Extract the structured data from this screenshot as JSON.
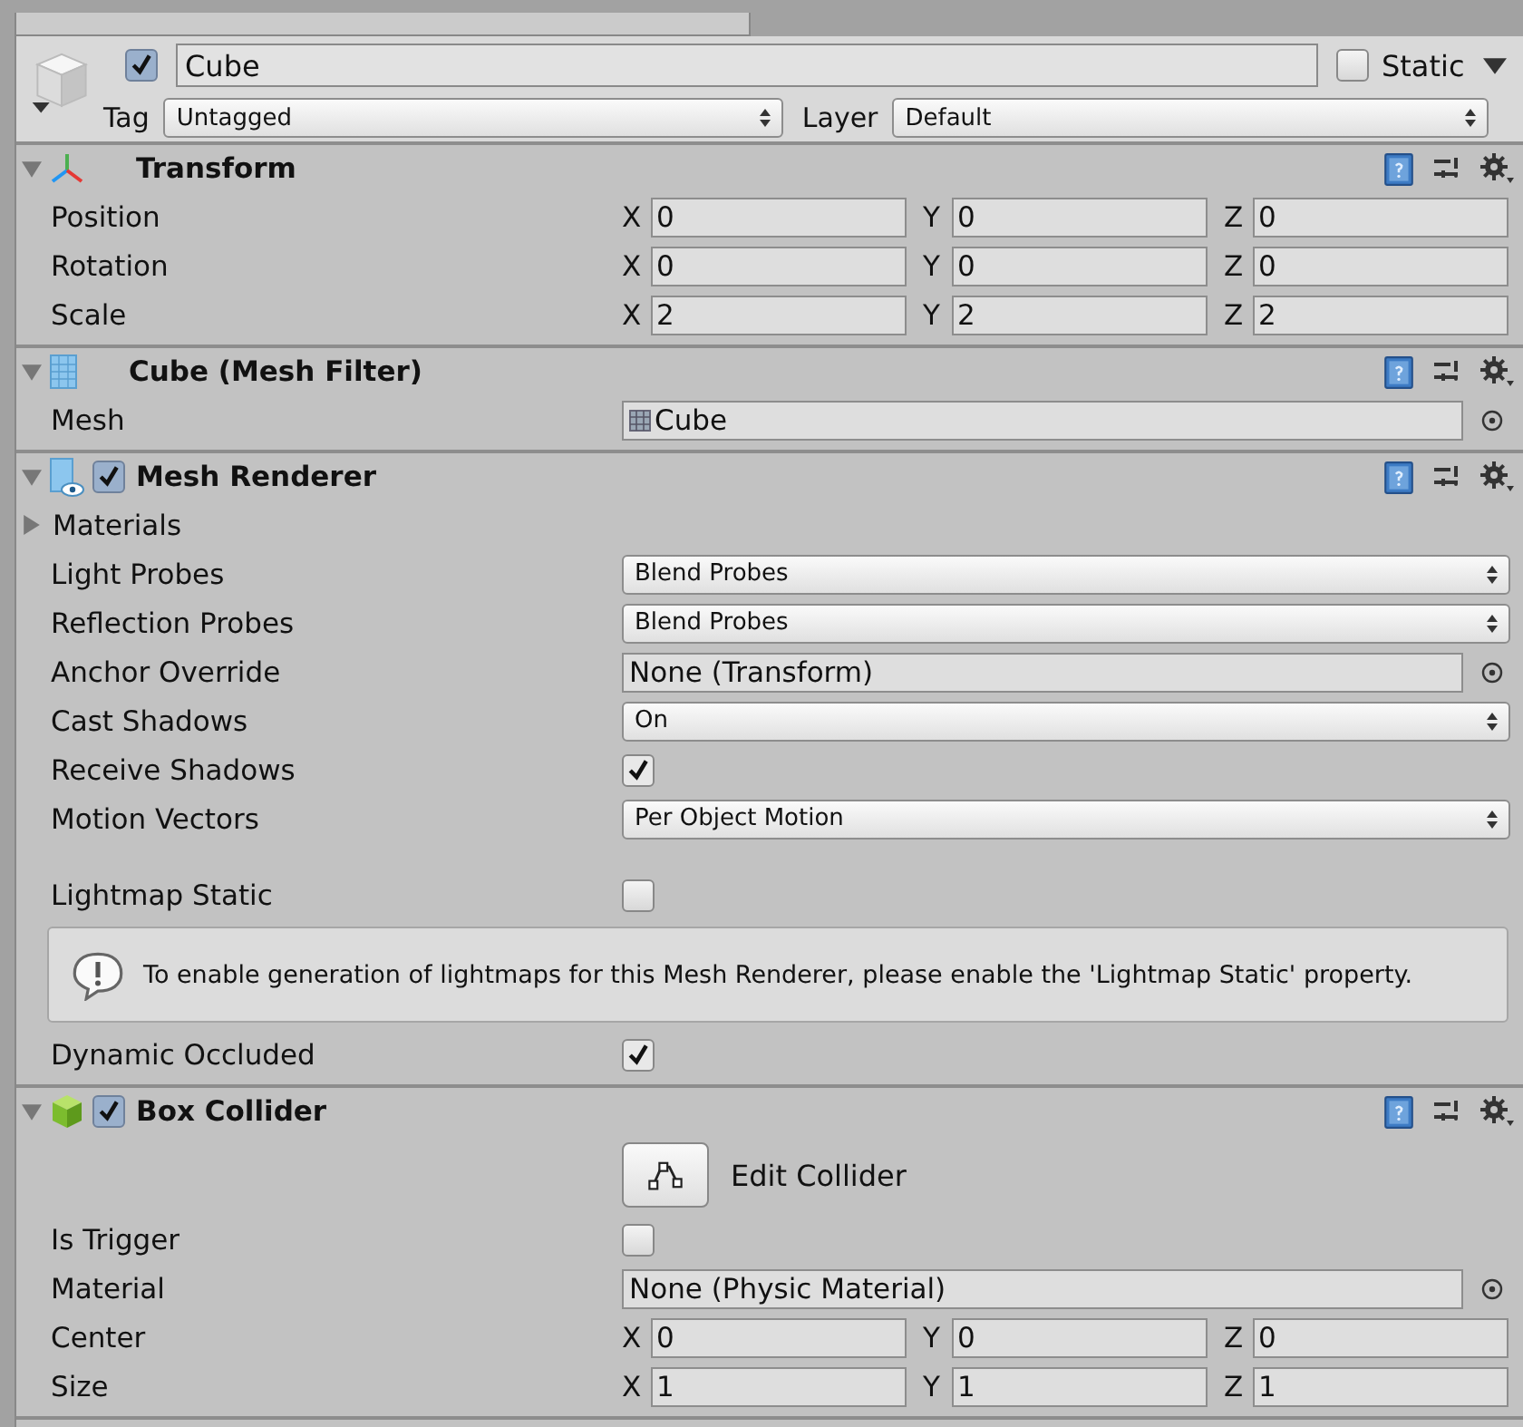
{
  "object": {
    "active": true,
    "name": "Cube",
    "static_label": "Static",
    "static": false,
    "tag_label": "Tag",
    "tag": "Untagged",
    "layer_label": "Layer",
    "layer": "Default"
  },
  "components": [
    {
      "kind": "transform",
      "title": "Transform",
      "expanded": true,
      "rows": [
        {
          "kind": "vector3",
          "label": "Position",
          "axes": [
            {
              "axis": "X",
              "value": "0"
            },
            {
              "axis": "Y",
              "value": "0"
            },
            {
              "axis": "Z",
              "value": "0"
            }
          ]
        },
        {
          "kind": "vector3",
          "label": "Rotation",
          "axes": [
            {
              "axis": "X",
              "value": "0"
            },
            {
              "axis": "Y",
              "value": "0"
            },
            {
              "axis": "Z",
              "value": "0"
            }
          ]
        },
        {
          "kind": "vector3",
          "label": "Scale",
          "axes": [
            {
              "axis": "X",
              "value": "2"
            },
            {
              "axis": "Y",
              "value": "2"
            },
            {
              "axis": "Z",
              "value": "2"
            }
          ]
        }
      ]
    },
    {
      "kind": "meshfilter",
      "title": "Cube (Mesh Filter)",
      "expanded": true,
      "rows": [
        {
          "kind": "object",
          "label": "Mesh",
          "value": "Cube",
          "asset": true
        }
      ]
    },
    {
      "kind": "renderer",
      "title": "Mesh Renderer",
      "enabled": true,
      "expanded": true,
      "rows": [
        {
          "kind": "foldout",
          "label": "Materials",
          "expanded": false
        },
        {
          "kind": "dropdown",
          "label": "Light Probes",
          "value": "Blend Probes"
        },
        {
          "kind": "dropdown",
          "label": "Reflection Probes",
          "value": "Blend Probes"
        },
        {
          "kind": "object",
          "label": "Anchor Override",
          "value": "None (Transform)",
          "asset": false
        },
        {
          "kind": "dropdown",
          "label": "Cast Shadows",
          "value": "On"
        },
        {
          "kind": "checkbox",
          "label": "Receive Shadows",
          "checked": true
        },
        {
          "kind": "dropdown",
          "label": "Motion Vectors",
          "value": "Per Object Motion"
        },
        {
          "kind": "spacer"
        },
        {
          "kind": "checkbox",
          "label": "Lightmap Static",
          "checked": false
        },
        {
          "kind": "helpbox",
          "text": "To enable generation of lightmaps for this Mesh Renderer, please enable the 'Lightmap Static' property."
        },
        {
          "kind": "checkbox",
          "label": "Dynamic Occluded",
          "checked": true
        }
      ]
    },
    {
      "kind": "collider",
      "title": "Box Collider",
      "enabled": true,
      "expanded": true,
      "rows": [
        {
          "kind": "button",
          "label": "Edit Collider"
        },
        {
          "kind": "checkbox",
          "label": "Is Trigger",
          "checked": false
        },
        {
          "kind": "object",
          "label": "Material",
          "value": "None (Physic Material)",
          "asset": false
        },
        {
          "kind": "vector3",
          "label": "Center",
          "axes": [
            {
              "axis": "X",
              "value": "0"
            },
            {
              "axis": "Y",
              "value": "0"
            },
            {
              "axis": "Z",
              "value": "0"
            }
          ]
        },
        {
          "kind": "vector3",
          "label": "Size",
          "axes": [
            {
              "axis": "X",
              "value": "1"
            },
            {
              "axis": "Y",
              "value": "1"
            },
            {
              "axis": "Z",
              "value": "1"
            }
          ]
        }
      ]
    }
  ]
}
